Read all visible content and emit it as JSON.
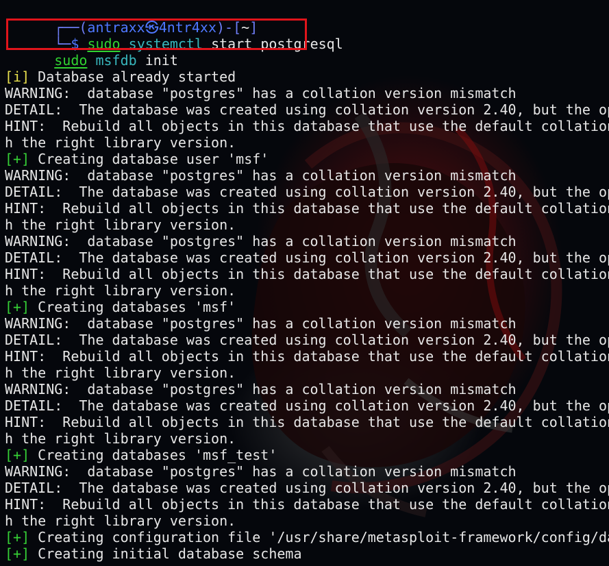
{
  "terminal": {
    "prompt": {
      "top_left": "┌──(",
      "user": "antraxx",
      "at": "㉿",
      "host": "4ntr4xx",
      "sep": ")-[",
      "cwd": "~",
      "close": "]",
      "bottom_left": "└─",
      "dollar": "$"
    },
    "command_1": {
      "sudo": "sudo",
      "prog": "systemctl",
      "args": " start postgresql"
    },
    "command_2": {
      "sudo": "sudo",
      "prog": "msfdb",
      "args": " init"
    },
    "output": [
      {
        "tag": "[i]",
        "text": " Database already started",
        "kind": "info"
      },
      {
        "tag": "",
        "text": "WARNING:  database \"postgres\" has a collation version mismatch",
        "kind": "plain"
      },
      {
        "tag": "",
        "text": "DETAIL:  The database was created using collation version 2.40, but the op",
        "kind": "plain"
      },
      {
        "tag": "",
        "text": "HINT:  Rebuild all objects in this database that use the default collation",
        "kind": "plain"
      },
      {
        "tag": "",
        "text": "h the right library version.",
        "kind": "plain"
      },
      {
        "tag": "[+]",
        "text": " Creating database user 'msf'",
        "kind": "plus"
      },
      {
        "tag": "",
        "text": "WARNING:  database \"postgres\" has a collation version mismatch",
        "kind": "plain"
      },
      {
        "tag": "",
        "text": "DETAIL:  The database was created using collation version 2.40, but the op",
        "kind": "plain"
      },
      {
        "tag": "",
        "text": "HINT:  Rebuild all objects in this database that use the default collation",
        "kind": "plain"
      },
      {
        "tag": "",
        "text": "h the right library version.",
        "kind": "plain"
      },
      {
        "tag": "",
        "text": "WARNING:  database \"postgres\" has a collation version mismatch",
        "kind": "plain"
      },
      {
        "tag": "",
        "text": "DETAIL:  The database was created using collation version 2.40, but the op",
        "kind": "plain"
      },
      {
        "tag": "",
        "text": "HINT:  Rebuild all objects in this database that use the default collation",
        "kind": "plain"
      },
      {
        "tag": "",
        "text": "h the right library version.",
        "kind": "plain"
      },
      {
        "tag": "[+]",
        "text": " Creating databases 'msf'",
        "kind": "plus"
      },
      {
        "tag": "",
        "text": "WARNING:  database \"postgres\" has a collation version mismatch",
        "kind": "plain"
      },
      {
        "tag": "",
        "text": "DETAIL:  The database was created using collation version 2.40, but the op",
        "kind": "plain"
      },
      {
        "tag": "",
        "text": "HINT:  Rebuild all objects in this database that use the default collation",
        "kind": "plain"
      },
      {
        "tag": "",
        "text": "h the right library version.",
        "kind": "plain"
      },
      {
        "tag": "",
        "text": "WARNING:  database \"postgres\" has a collation version mismatch",
        "kind": "plain"
      },
      {
        "tag": "",
        "text": "DETAIL:  The database was created using collation version 2.40, but the op",
        "kind": "plain"
      },
      {
        "tag": "",
        "text": "HINT:  Rebuild all objects in this database that use the default collation",
        "kind": "plain"
      },
      {
        "tag": "",
        "text": "h the right library version.",
        "kind": "plain"
      },
      {
        "tag": "[+]",
        "text": " Creating databases 'msf_test'",
        "kind": "plus"
      },
      {
        "tag": "",
        "text": "WARNING:  database \"postgres\" has a collation version mismatch",
        "kind": "plain"
      },
      {
        "tag": "",
        "text": "DETAIL:  The database was created using collation version 2.40, but the op",
        "kind": "plain"
      },
      {
        "tag": "",
        "text": "HINT:  Rebuild all objects in this database that use the default collation",
        "kind": "plain"
      },
      {
        "tag": "",
        "text": "h the right library version.",
        "kind": "plain"
      },
      {
        "tag": "[+]",
        "text": " Creating configuration file '/usr/share/metasploit-framework/config/da",
        "kind": "plus"
      },
      {
        "tag": "[+]",
        "text": " Creating initial database schema",
        "kind": "plus"
      }
    ]
  },
  "colors": {
    "background": "#05070c",
    "text": "#d8d8d8",
    "prompt_purple": "#6f7ef7",
    "prompt_blue": "#4f77ff",
    "command_green": "#31d431",
    "command_teal": "#38b7bd",
    "info_yellow": "#e8e04d",
    "plus_green": "#36d136",
    "highlight_red": "#e0141b"
  }
}
